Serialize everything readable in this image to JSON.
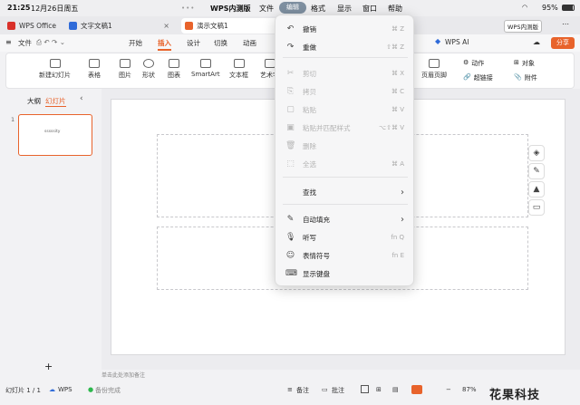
{
  "status": {
    "time": "21:25",
    "date": "12月26日周五",
    "battery": "95%"
  },
  "app_menu": {
    "app": "WPS内测版",
    "items": [
      "文件",
      "编辑",
      "格式",
      "显示",
      "窗口",
      "帮助"
    ]
  },
  "tabs": [
    {
      "label": "WPS Office"
    },
    {
      "label": "文字文稿1"
    },
    {
      "label": "演示文稿1"
    }
  ],
  "tab_extra": {
    "badge": "WPS内测版",
    "share": "分享",
    "ai": "WPS AI"
  },
  "ribbon": {
    "file": "文件",
    "tabs": [
      "开始",
      "插入",
      "设计",
      "切换",
      "动画"
    ],
    "active_tab": "插入"
  },
  "toolbar": {
    "new_slide": "新建幻灯片",
    "table": "表格",
    "picture": "图片",
    "shape": "形状",
    "chart": "图表",
    "smartart": "SmartArt",
    "textbox": "文本框",
    "art": "艺术字",
    "header_footer": "页眉页脚",
    "action": "动作",
    "object": "对象",
    "hyperlink": "超链接",
    "attachment": "附件"
  },
  "panel": {
    "outline": "大纲",
    "slides": "幻灯片",
    "thumb_number": "1",
    "thumb_text": "sssssity",
    "add": "+"
  },
  "notes_placeholder": "单击此处添加备注",
  "bottom": {
    "slide_count": "幻灯片 1 / 1",
    "wps": "WPS",
    "backup": "备份完成",
    "notes": "备注",
    "comment": "批注",
    "zoom": "87%"
  },
  "watermark": "花果科技",
  "edit_menu": {
    "items": [
      {
        "icon": "↶",
        "label": "撤销",
        "key": "⌘ Z",
        "disabled": false
      },
      {
        "icon": "↷",
        "label": "重做",
        "key": "⇧⌘ Z",
        "disabled": false
      },
      {
        "icon": "✂",
        "label": "剪切",
        "key": "⌘ X",
        "disabled": true
      },
      {
        "icon": "⎘",
        "label": "拷贝",
        "key": "⌘ C",
        "disabled": true
      },
      {
        "icon": "▢",
        "label": "粘贴",
        "key": "⌘ V",
        "disabled": true
      },
      {
        "icon": "▣",
        "label": "粘贴并匹配样式",
        "key": "⌥⇧⌘ V",
        "disabled": true
      },
      {
        "icon": "🗑",
        "label": "删除",
        "key": "",
        "disabled": true
      },
      {
        "icon": "⬚",
        "label": "全选",
        "key": "⌘ A",
        "disabled": true
      },
      {
        "icon": "",
        "label": "查找",
        "key": "›",
        "disabled": false
      },
      {
        "icon": "✎",
        "label": "自动填充",
        "key": "›",
        "disabled": false
      },
      {
        "icon": "🎙",
        "label": "听写",
        "key": "fn Q",
        "disabled": false
      },
      {
        "icon": "☺",
        "label": "表情符号",
        "key": "fn E",
        "disabled": false
      },
      {
        "icon": "⌨",
        "label": "显示键盘",
        "key": "",
        "disabled": false
      }
    ]
  },
  "colors": {
    "accent": "#e8632b",
    "wps_red": "#d9302a",
    "doc_blue": "#2f6bd9"
  }
}
